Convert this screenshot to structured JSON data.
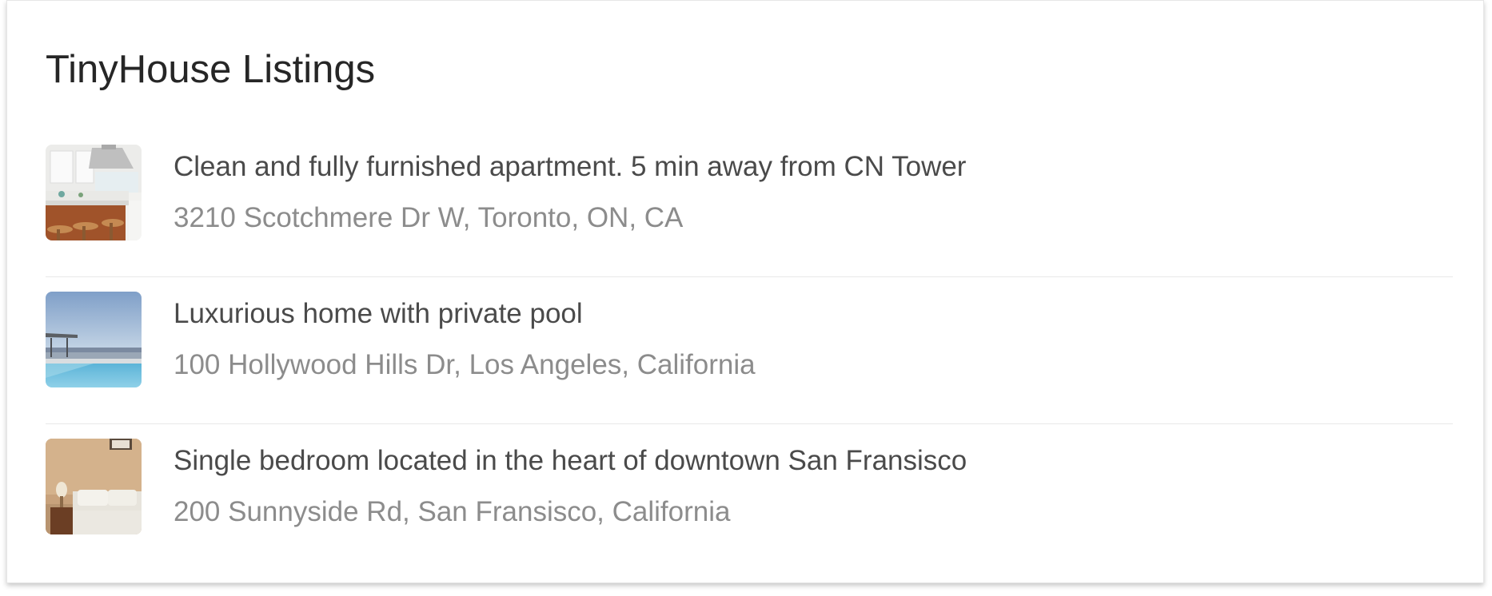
{
  "header": {
    "title": "TinyHouse Listings"
  },
  "listings": [
    {
      "title": "Clean and fully furnished apartment. 5 min away from CN Tower",
      "address": "3210 Scotchmere Dr W, Toronto, ON, CA",
      "image_icon": "kitchen-photo"
    },
    {
      "title": "Luxurious home with private pool",
      "address": "100 Hollywood Hills Dr, Los Angeles, California",
      "image_icon": "pool-photo"
    },
    {
      "title": "Single bedroom located in the heart of downtown San Fransisco",
      "address": "200 Sunnyside Rd, San Fransisco, California",
      "image_icon": "bedroom-photo"
    }
  ],
  "colors": {
    "title": "#262626",
    "listing_title": "#4a4a4a",
    "listing_address": "#8c8c8c",
    "divider": "#e8e8e8"
  }
}
